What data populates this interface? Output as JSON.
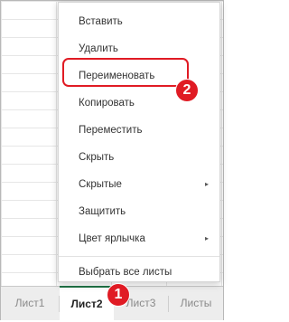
{
  "context_menu": {
    "items": [
      {
        "label": "Вставить"
      },
      {
        "label": "Удалить"
      },
      {
        "label": "Переименовать"
      },
      {
        "label": "Копировать"
      },
      {
        "label": "Переместить"
      },
      {
        "label": "Скрыть"
      },
      {
        "label": "Скрытые",
        "submenu": true
      },
      {
        "label": "Защитить"
      },
      {
        "label": "Цвет ярлычка",
        "submenu": true
      },
      {
        "label": "Выбрать все листы"
      }
    ],
    "submenu_glyph": "▸"
  },
  "sheet_tabs": [
    {
      "label": "Лист1",
      "active": false
    },
    {
      "label": "Лист2",
      "active": true
    },
    {
      "label": "Лист3",
      "active": false
    },
    {
      "label": "Листы",
      "active": false
    }
  ],
  "annotations": {
    "step1": "1",
    "step2": "2",
    "accent_color": "#e01b24"
  }
}
